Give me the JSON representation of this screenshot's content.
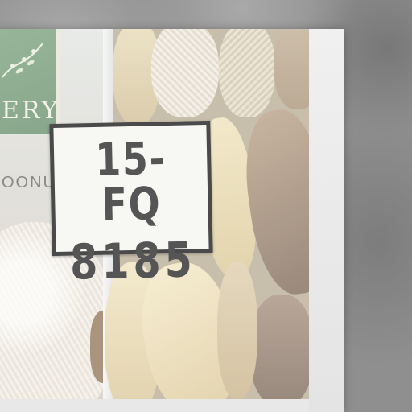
{
  "plate": {
    "line1": "15-FQ",
    "line2": "8185"
  },
  "box": {
    "brand_text": "ERY",
    "product_text": "OONUT"
  },
  "colors": {
    "plate_border": "#4a4a4a",
    "plate_text": "#555555",
    "box_green": "#6f9a72"
  }
}
